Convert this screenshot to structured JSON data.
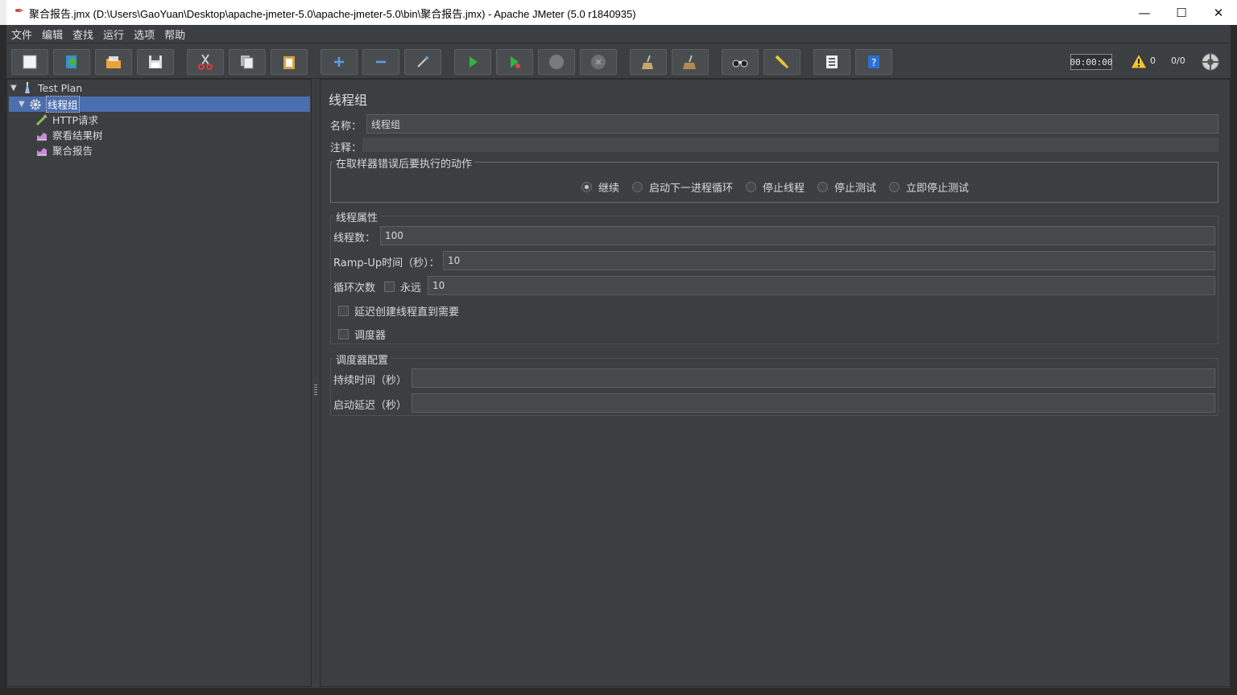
{
  "window": {
    "title": "聚合报告.jmx (D:\\Users\\GaoYuan\\Desktop\\apache-jmeter-5.0\\apache-jmeter-5.0\\bin\\聚合报告.jmx) - Apache JMeter (5.0 r1840935)",
    "minimize": "—",
    "maximize": "☐",
    "close": "✕"
  },
  "menu": [
    "文件",
    "编辑",
    "查找",
    "运行",
    "选项",
    "帮助"
  ],
  "toolbar": {
    "timer": "00:00:00",
    "warning_count": "0",
    "thread_ratio": "0/0"
  },
  "tree": {
    "root": "Test Plan",
    "thread_group": "线程组",
    "children": [
      "HTTP请求",
      "察看结果树",
      "聚合报告"
    ]
  },
  "panel": {
    "title": "线程组",
    "name_label": "名称：",
    "name_value": "线程组",
    "comment_label": "注释：",
    "comment_value": "",
    "error_action": {
      "legend": "在取样器错误后要执行的动作",
      "options": [
        "继续",
        "启动下一进程循环",
        "停止线程",
        "停止测试",
        "立即停止测试"
      ],
      "selected": "继续"
    },
    "thread_props": {
      "legend": "线程属性",
      "threads_label": "线程数：",
      "threads_value": "100",
      "rampup_label": "Ramp-Up时间（秒）：",
      "rampup_value": "10",
      "loop_label": "循环次数",
      "forever_label": "永远",
      "loop_value": "10",
      "delay_label": "延迟创建线程直到需要",
      "scheduler_label": "调度器"
    },
    "scheduler": {
      "legend": "调度器配置",
      "duration_label": "持续时间（秒）",
      "duration_value": "",
      "startup_label": "启动延迟（秒）",
      "startup_value": ""
    }
  }
}
